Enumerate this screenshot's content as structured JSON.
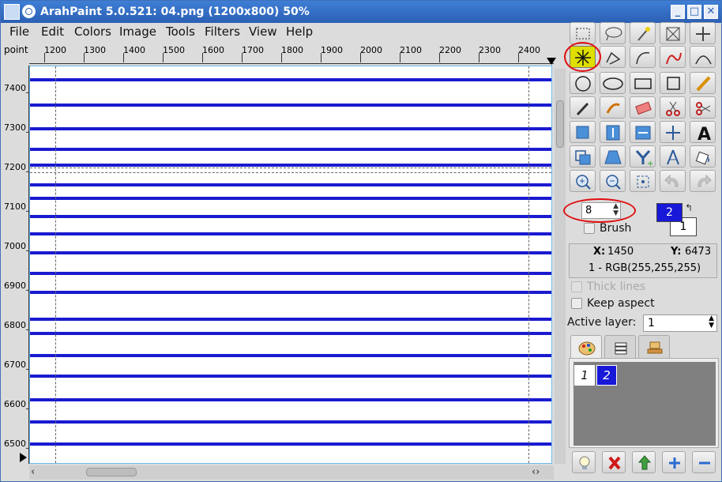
{
  "window": {
    "title": "ArahPaint 5.0.521: 04.png  (1200x800) 50%",
    "controls": [
      "_",
      "□",
      "✕"
    ]
  },
  "menu": [
    "File",
    "Edit",
    "Colors",
    "Image",
    "Tools",
    "Filters",
    "View",
    "Help"
  ],
  "ruler": {
    "unit": "point",
    "horizontal_ticks": [
      "1200",
      "1300",
      "1400",
      "1500",
      "1600",
      "1700",
      "1800",
      "1900",
      "2000",
      "2100",
      "2200",
      "2300",
      "2400"
    ],
    "vertical_ticks": [
      "7400_",
      "7300_",
      "7200_",
      "7100_",
      "7000_",
      "6900_",
      "6800_",
      "6700_",
      "6600_",
      "6500_"
    ]
  },
  "tools": {
    "selected": "asterisk-tool",
    "brush_size": "8",
    "brush_label": "Brush",
    "foreground_index": "2",
    "background_index": "1"
  },
  "info": {
    "x_label": "X:",
    "x_value": "1450",
    "y_label": "Y:",
    "y_value": "6473",
    "color": "1 - RGB(255,255,255)"
  },
  "options": {
    "thick_lines": "Thick lines",
    "keep_aspect": "Keep aspect",
    "active_layer_label": "Active layer:",
    "active_layer_value": "1"
  },
  "layers": [
    "1",
    "2"
  ],
  "colors": {
    "line_color": "#1a1ad0",
    "selected_layer": "#1818d8",
    "accent_circle": "#e01010"
  }
}
